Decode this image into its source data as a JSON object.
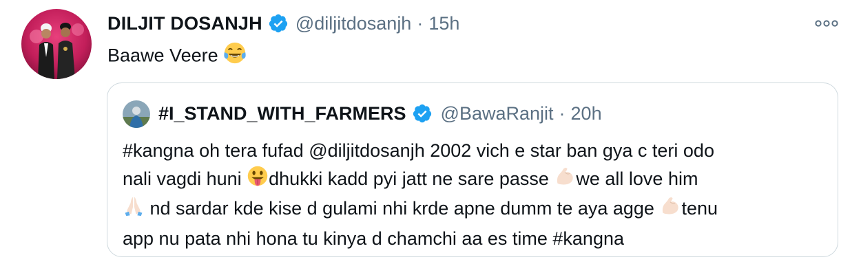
{
  "tweet": {
    "author_name": "DILJIT DOSANJH",
    "author_handle": "@diljitdosanjh",
    "separator": "·",
    "time": "15h",
    "text": "Baawe Veere",
    "text_emoji": "face-with-tears-of-joy"
  },
  "quoted": {
    "author_name": "#I_STAND_WITH_FARMERS",
    "author_handle": "@BawaRanjit",
    "separator": "·",
    "time": "20h",
    "line1": "#kangna oh tera fufad @diljitdosanjh 2002  vich e star ban gya c teri odo",
    "line2_a": "nali vagdi huni ",
    "line2_b": "dhukki kadd pyi jatt ne sare passe ",
    "line2_c": "we all love him",
    "line3_a": " nd sardar kde kise d gulami nhi krde apne dumm te aya agge ",
    "line3_b": "tenu",
    "line4": "app nu pata nhi hona tu kinya d chamchi  aa es time #kangna"
  },
  "colors": {
    "verified": "#1da1f2",
    "secondary_text": "#5b7083",
    "border": "#cfd9de"
  },
  "icons": [
    "verified-badge-icon",
    "more-options-icon",
    "face-with-tears-of-joy-emoji",
    "face-with-tongue-emoji",
    "flexed-biceps-emoji",
    "folded-hands-emoji"
  ]
}
